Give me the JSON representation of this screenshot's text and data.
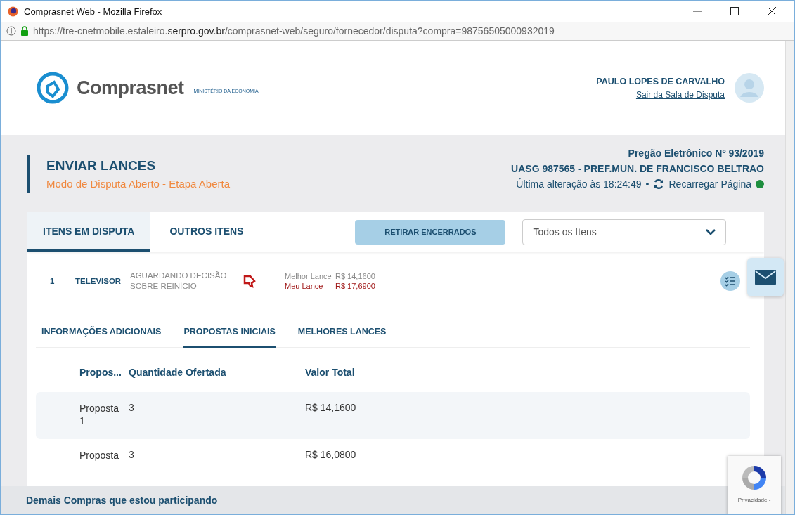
{
  "window": {
    "title": "Comprasnet Web - Mozilla Firefox"
  },
  "address_bar": {
    "url": "https://tre-cnetmobile.estaleiro.**serpro.gov.br**/comprasnet-web/seguro/fornecedor/disputa?compra=98756505000932019"
  },
  "header": {
    "logo": "Comprasnet",
    "ministry": "MINISTÉRIO DA ECONOMIA",
    "user": "PAULO LOPES DE CARVALHO",
    "logout": "Sair da Sala de Disputa"
  },
  "page": {
    "title": "ENVIAR LANCES",
    "subtitle": "Modo de Disputa Aberto - Etapa Aberta",
    "pregao": "Pregão Eletrônico Nº 93/2019",
    "uasg": "UASG 987565 - PREF.MUN. DE FRANCISCO BELTRAO",
    "last_update": "Última alteração às 18:24:49",
    "separator": "•",
    "reload": "Recarregar Página",
    "status": {
      "color": "#1e8e3e"
    }
  },
  "tabs": [
    {
      "label": "ITENS EM DISPUTA",
      "selected": true
    },
    {
      "label": "OUTROS ITENS",
      "selected": false
    }
  ],
  "remove_button": "RETIRAR ENCERRADOS",
  "filter": {
    "value": "Todos os Itens"
  },
  "item": {
    "number": "1",
    "name": "TELEVISOR",
    "status": "AGUARDANDO DECISÃO SOBRE REINÍCIO",
    "best_label": "Melhor Lance",
    "best_value": "R$ 14,1600",
    "my_label": "Meu Lance",
    "my_value": "R$ 17,6900"
  },
  "subtabs": [
    {
      "label": "INFORMAÇÕES ADICIONAIS",
      "selected": false
    },
    {
      "label": "PROPOSTAS INICIAIS",
      "selected": true
    },
    {
      "label": "MELHORES LANCES",
      "selected": false
    }
  ],
  "table": {
    "columns": [
      "Propos...",
      "Quantidade Ofertada",
      "Valor Total"
    ],
    "rows": [
      [
        "Proposta 1",
        "3",
        "R$ 14,1600"
      ],
      [
        "Proposta",
        "3",
        "R$ 16,0800"
      ]
    ]
  },
  "footer": "Demais Compras que estou participando",
  "recaptcha": "Privacidade -"
}
